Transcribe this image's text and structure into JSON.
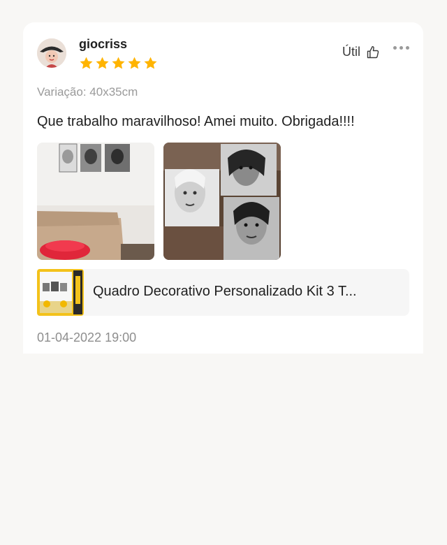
{
  "review": {
    "username": "giocriss",
    "rating": 5,
    "useful_label": "Útil",
    "variation": "Variação: 40x35cm",
    "text": "Que trabalho maravilhoso! Amei muito. Obrigada!!!!",
    "timestamp": "01-04-2022 19:00",
    "photos": [
      "photo-wall-with-three-frames",
      "photo-three-portrait-frames"
    ]
  },
  "product": {
    "title": "Quadro Decorativo Personalizado Kit 3 T..."
  },
  "icons": {
    "star": "star-icon",
    "useful": "thumbs-up-icon",
    "more": "more-options-icon"
  },
  "colors": {
    "star": "#ffb400",
    "secondary_text": "#9a9a9a",
    "product_bg": "#f6f6f6"
  }
}
